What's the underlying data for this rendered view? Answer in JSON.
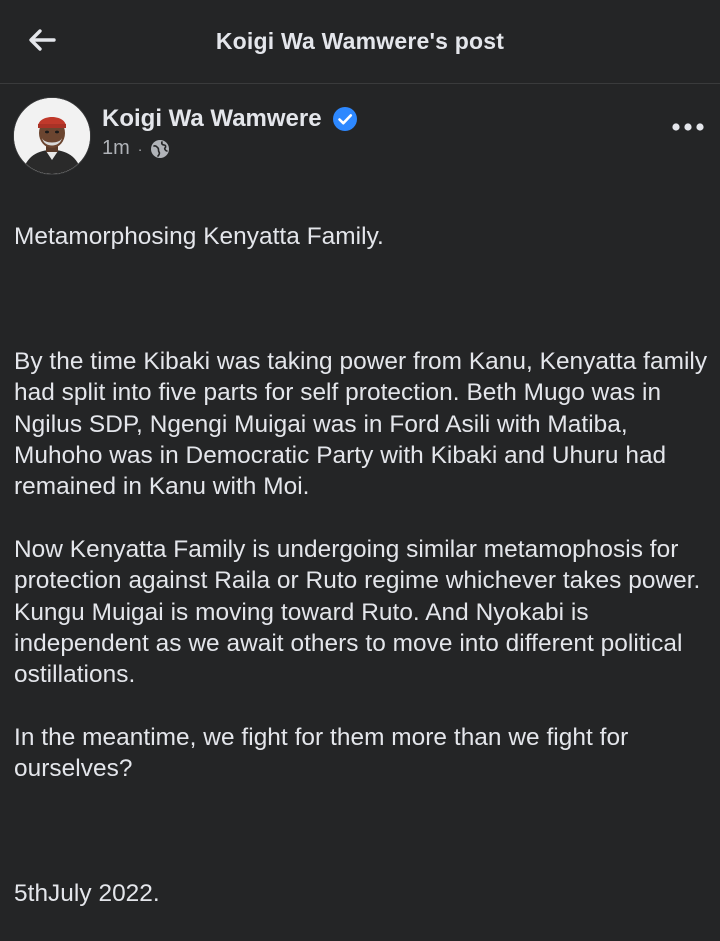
{
  "header": {
    "title": "Koigi Wa Wamwere's post",
    "back_icon": "arrow-left-icon"
  },
  "post": {
    "author": "Koigi Wa Wamwere",
    "verified": true,
    "time": "1m",
    "separator": "·",
    "audience_icon": "globe-icon",
    "more_icon": "more-options-icon",
    "title_line": "Metamorphosing Kenyatta Family.",
    "paragraph_1": "By the time Kibaki was taking power from Kanu, Kenyatta family had split into five parts for self protection. Beth Mugo was in Ngilus SDP, Ngengi Muigai was in Ford Asili with Matiba, Muhoho was in Democratic Party with Kibaki and Uhuru had remained in Kanu with Moi.",
    "paragraph_2": "Now Kenyatta Family is undergoing similar metamophosis for protection against Raila or Ruto regime whichever takes power. Kungu Muigai is moving toward Ruto. And Nyokabi is independent as we await others to move into different political ostillations.",
    "paragraph_3": "In the meantime, we fight for them more than we fight for ourselves?",
    "date_line": "5thJuly 2022."
  },
  "colors": {
    "background": "#242526",
    "text_primary": "#e4e6eb",
    "text_secondary": "#b0b3b8",
    "verified_blue": "#2d88ff"
  }
}
